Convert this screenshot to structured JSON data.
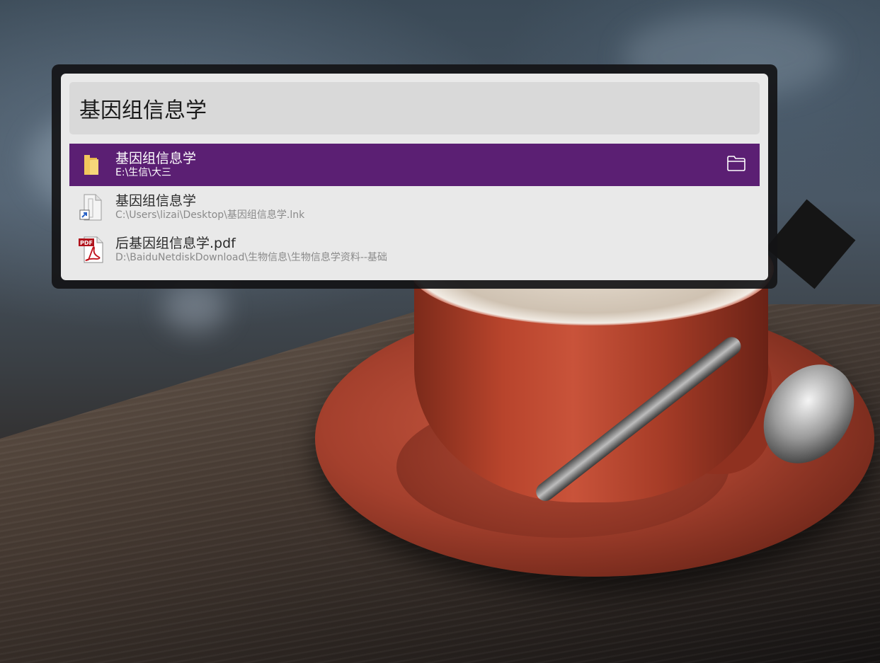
{
  "launcher": {
    "query": "基因组信息学",
    "results": [
      {
        "title": "基因组信息学",
        "subtitle": "E:\\生信\\大三",
        "icon": "folder-icon",
        "selected": true,
        "action_icon": "open-folder-icon"
      },
      {
        "title": "基因组信息学",
        "subtitle": "C:\\Users\\lizai\\Desktop\\基因组信息学.lnk",
        "icon": "shortcut-file-icon",
        "selected": false
      },
      {
        "title": "后基因组信息学.pdf",
        "subtitle": "D:\\BaiduNetdiskDownload\\生物信息\\生物信息学资料--基础",
        "icon": "pdf-file-icon",
        "icon_label": "PDF",
        "selected": false
      }
    ]
  },
  "colors": {
    "selected_row": "#5b1f73",
    "panel_background": "#e9e9e9",
    "query_background": "#d9d9d9",
    "frame": "#141416"
  }
}
